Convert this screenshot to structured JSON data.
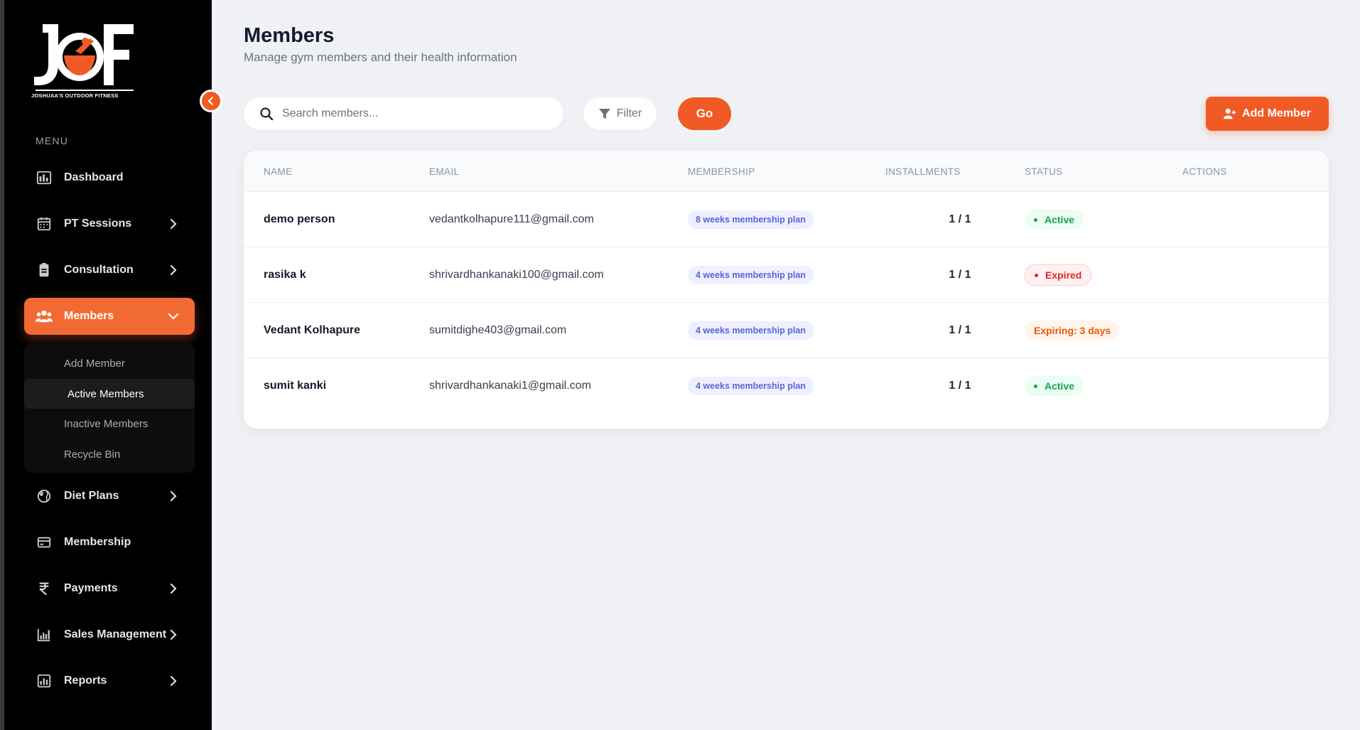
{
  "sidebar": {
    "logo_text": "JOSHUAA'S OUTDOOR FITNESS",
    "menu_label": "MENU",
    "items": [
      {
        "label": "Dashboard",
        "icon": "dashboard-icon",
        "has_chevron": false
      },
      {
        "label": "PT Sessions",
        "icon": "calendar-icon",
        "has_chevron": true
      },
      {
        "label": "Consultation",
        "icon": "clipboard-icon",
        "has_chevron": true
      },
      {
        "label": "Members",
        "icon": "users-icon",
        "has_chevron": true,
        "active": true
      },
      {
        "label": "Diet Plans",
        "icon": "diet-icon",
        "has_chevron": true
      },
      {
        "label": "Membership",
        "icon": "card-icon",
        "has_chevron": false
      },
      {
        "label": "Payments",
        "icon": "rupee-icon",
        "has_chevron": true
      },
      {
        "label": "Sales Management",
        "icon": "bar-chart-icon",
        "has_chevron": true
      },
      {
        "label": "Reports",
        "icon": "report-icon",
        "has_chevron": true
      }
    ],
    "submenu": [
      {
        "label": "Add Member"
      },
      {
        "label": "Active Members",
        "active": true
      },
      {
        "label": "Inactive Members"
      },
      {
        "label": "Recycle Bin"
      }
    ]
  },
  "header": {
    "title": "Members",
    "subtitle": "Manage gym members and their health information"
  },
  "toolbar": {
    "search_placeholder": "Search members...",
    "filter_label": "Filter",
    "go_label": "Go",
    "add_label": "Add Member"
  },
  "table": {
    "columns": [
      "NAME",
      "EMAIL",
      "MEMBERSHIP",
      "INSTALLMENTS",
      "STATUS",
      "ACTIONS"
    ],
    "rows": [
      {
        "name": "demo person",
        "email": "vedantkolhapure111@gmail.com",
        "plan": "8 weeks membership plan",
        "installments": "1 / 1",
        "status": "Active"
      },
      {
        "name": "rasika k",
        "email": "shrivardhankanaki100@gmail.com",
        "plan": "4 weeks membership plan",
        "installments": "1 / 1",
        "status": "Expired"
      },
      {
        "name": "Vedant Kolhapure",
        "email": "sumitdighe403@gmail.com",
        "plan": "4 weeks membership plan",
        "installments": "1 / 1",
        "status": "Expiring: 3 days"
      },
      {
        "name": "sumit kanki",
        "email": "shrivardhankanaki1@gmail.com",
        "plan": "4 weeks membership plan",
        "installments": "1 / 1",
        "status": "Active"
      }
    ]
  },
  "colors": {
    "accent": "#f05a24",
    "sidebar_bg": "#000000",
    "page_bg": "#f0f1f5",
    "active_green": "#16a34a",
    "expired_red": "#dc2626",
    "expiring_orange": "#ea580c"
  }
}
